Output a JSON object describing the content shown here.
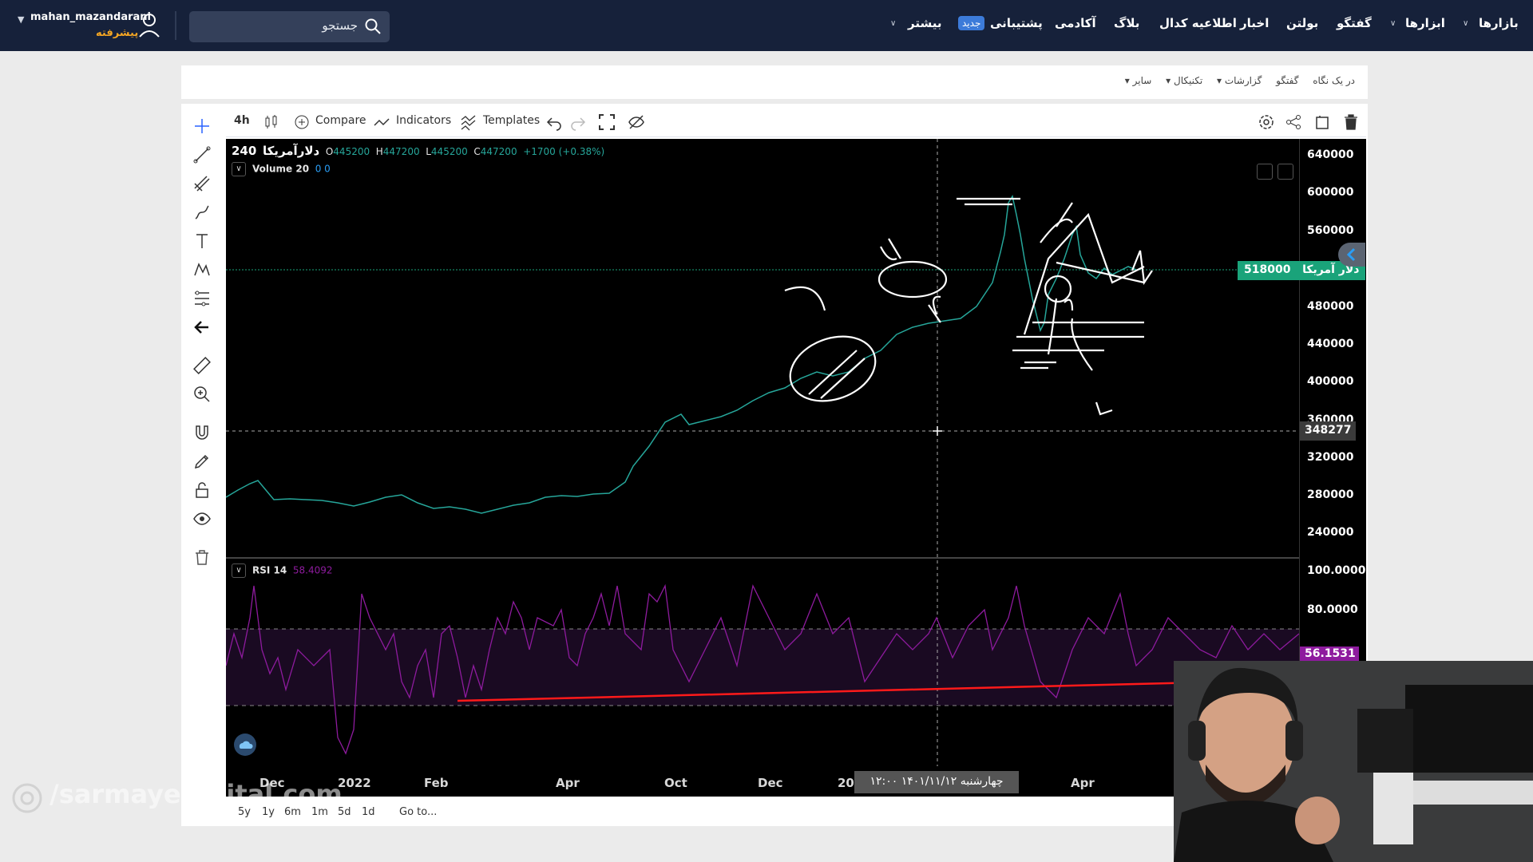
{
  "topnav": {
    "username": "mahan_mazandarani",
    "user_tier": "پیشرفته",
    "search_placeholder": "جستجو",
    "menu": {
      "markets": "بازارها",
      "tools": "ابزارها",
      "chat": "گفتگو",
      "bulletin": "بولتن",
      "news": "اخبار",
      "codal": "اطلاعیه کدال",
      "blog": "بلاگ",
      "academy": "آکادمی",
      "support": "پشتیبانی",
      "new_badge": "جدید",
      "more": "بیشتر"
    }
  },
  "breadcrumbs": [
    "در یک نگاه",
    "گفتگو",
    "گزارشات ▾",
    "تکنیکال ▾",
    "سایر ▾"
  ],
  "toolbar": {
    "interval": "4h",
    "compare": "Compare",
    "indicators": "Indicators",
    "templates": "Templates"
  },
  "legend": {
    "symbol": "دلارآمریکا",
    "interval_value": "240",
    "open_label": "O",
    "open": "445200",
    "high_label": "H",
    "high": "447200",
    "low_label": "L",
    "low": "445200",
    "close_label": "C",
    "close": "447200",
    "change": "+1700 (+0.38%)",
    "volume_label": "Volume 20",
    "volume_vals": "0 0",
    "rsi_label": "RSI 14",
    "rsi_value": "58.4092"
  },
  "price_axis": [
    "640000",
    "600000",
    "560000",
    "518000",
    "480000",
    "440000",
    "400000",
    "360000",
    "320000",
    "280000",
    "240000"
  ],
  "rsi_axis": [
    "100.0000",
    "80.0000"
  ],
  "current_price_tag": {
    "name": "دلار آمریکا",
    "value": "518000"
  },
  "crosshair": {
    "price": "348277",
    "rsi": "56.1531",
    "date": "چهارشنبه ۱۴۰۱/۱۱/۱۲  ۱۲:۰۰"
  },
  "time_axis": [
    "Dec",
    "2022",
    "Feb",
    "Apr",
    "Oct",
    "Dec",
    "20",
    "Apr"
  ],
  "ranges": [
    "5y",
    "1y",
    "6m",
    "1m",
    "5d",
    "1d",
    "Go to..."
  ],
  "watermark": "/sarmayedigital.com",
  "colors": {
    "nav_bg": "#16213a",
    "price_tag": "#1aa37a",
    "rsi_line": "#8e1b9e",
    "trend_line": "#ff1a1a"
  }
}
